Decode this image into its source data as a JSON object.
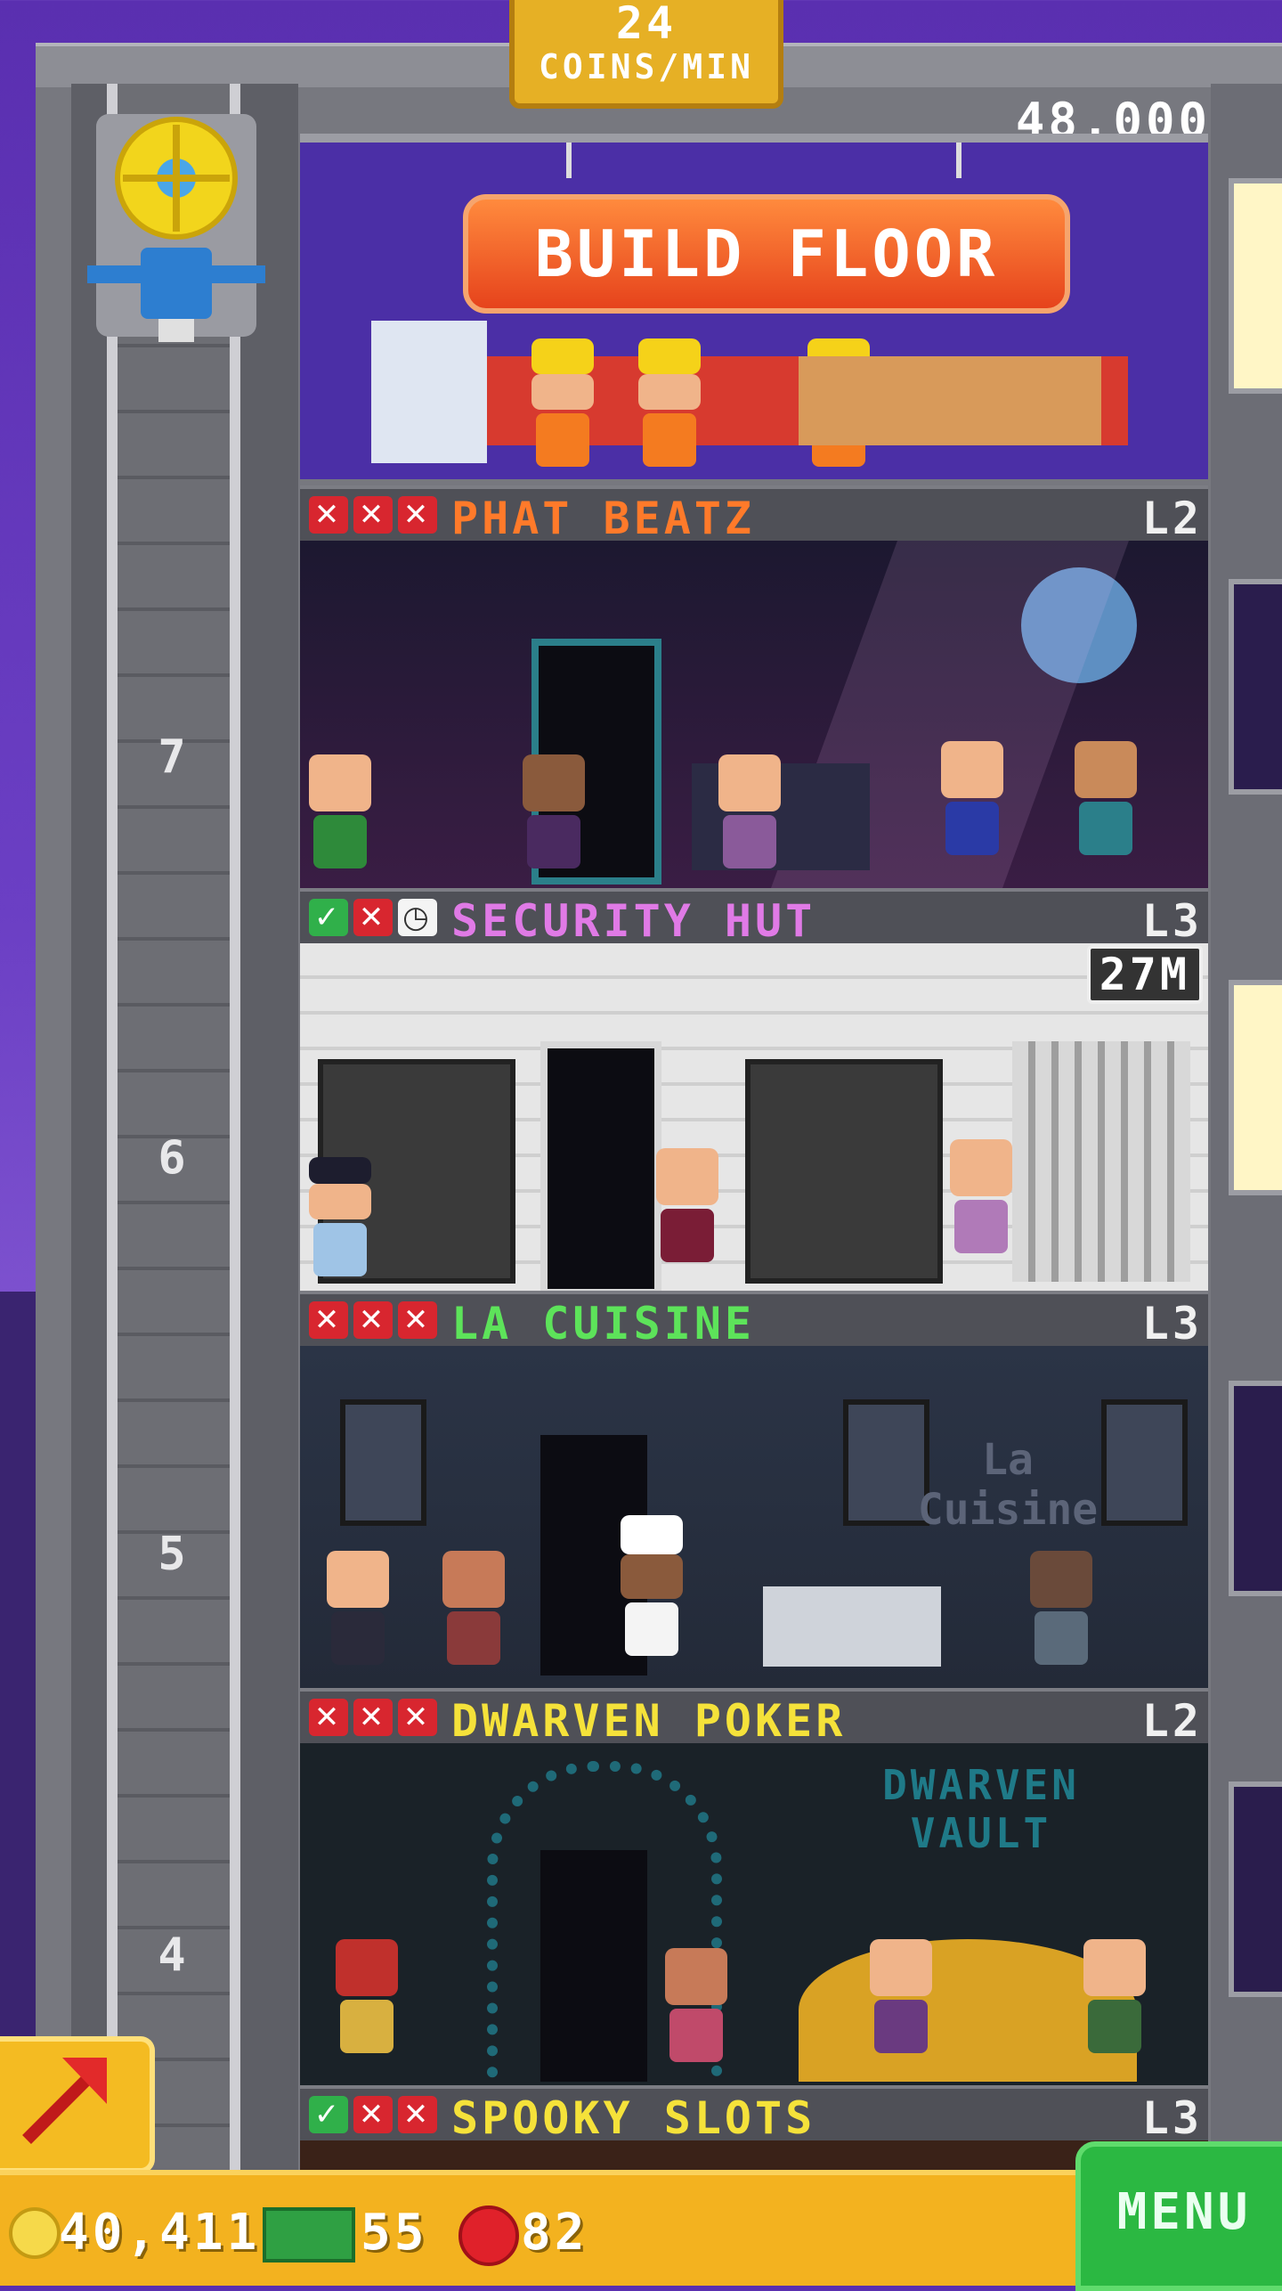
{
  "header": {
    "coins_per_min_value": "24",
    "coins_per_min_label": "COINS/MIN",
    "build_cost": "48,000"
  },
  "build_floor_label": "BUILD FLOOR",
  "floors": [
    {
      "name": "PHAT BEATZ",
      "level": "L2",
      "name_color": "#ff7a2a",
      "marks": [
        "x",
        "x",
        "x"
      ],
      "number": "7"
    },
    {
      "name": "SECURITY HUT",
      "level": "L3",
      "name_color": "#e07ae6",
      "marks": [
        "ok",
        "x",
        "clock"
      ],
      "number": "6",
      "badge": "27M"
    },
    {
      "name": "LA CUISINE",
      "level": "L3",
      "name_color": "#5de35a",
      "marks": [
        "x",
        "x",
        "x"
      ],
      "number": "5"
    },
    {
      "name": "DWARVEN POKER",
      "level": "L2",
      "name_color": "#f5e23a",
      "marks": [
        "x",
        "x",
        "x"
      ],
      "number": "4"
    },
    {
      "name": "SPOOKY SLOTS",
      "level": "L3",
      "name_color": "#f5e23a",
      "marks": [
        "ok",
        "x",
        "x"
      ]
    }
  ],
  "scene_text": {
    "cuisine_sign": "La Cuisine",
    "vault_sign": "DWARVEN VAULT"
  },
  "bottom_bar": {
    "coins": "40,411",
    "bux": "55",
    "gems": "82",
    "menu_label": "MENU"
  },
  "icons": [
    "elevator-icon",
    "coin-icon",
    "bux-icon",
    "gem-icon",
    "arrow-up-right-icon",
    "x-mark-icon",
    "check-mark-icon",
    "clock-icon"
  ]
}
